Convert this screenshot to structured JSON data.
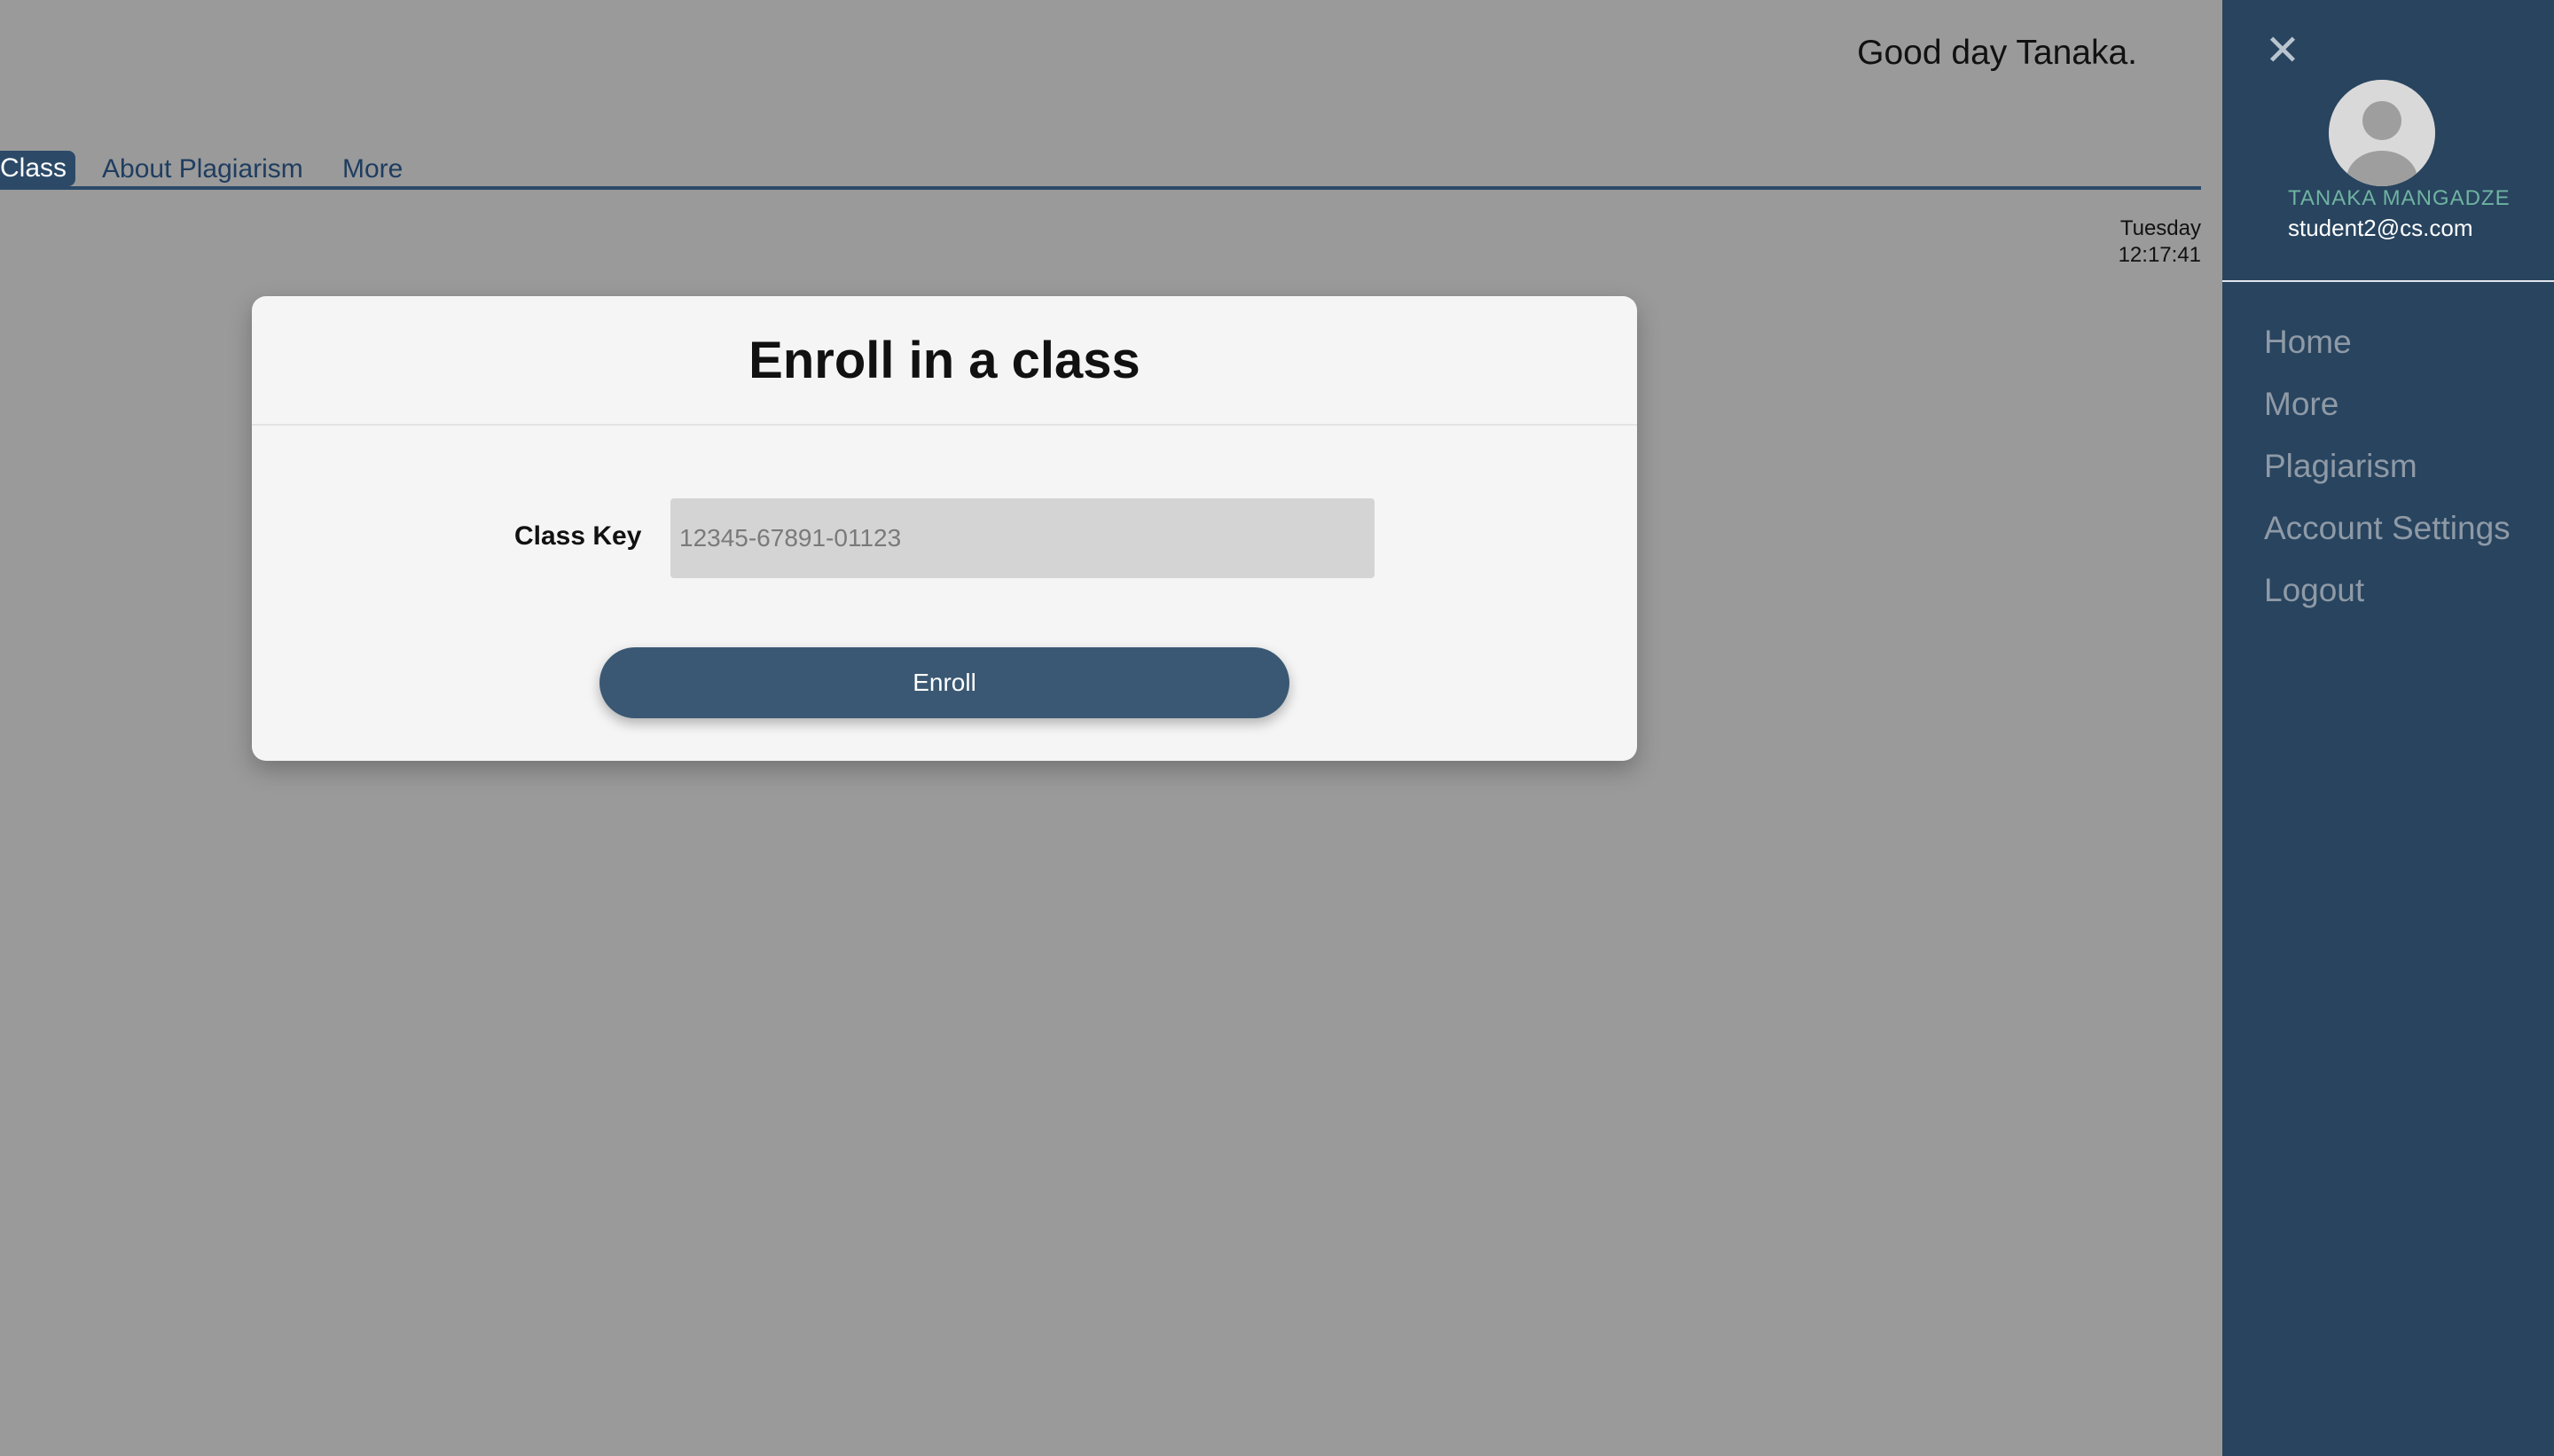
{
  "header": {
    "greeting": "Good day Tanaka."
  },
  "tabs": [
    {
      "label": "Class",
      "active": true
    },
    {
      "label": "About Plagiarism",
      "active": false
    },
    {
      "label": "More",
      "active": false
    }
  ],
  "clock": {
    "day": "Tuesday",
    "time": "12:17:41"
  },
  "modal": {
    "title": "Enroll in a class",
    "field_label": "Class Key",
    "field_placeholder": "12345-67891-01123",
    "field_value": "",
    "submit_label": "Enroll"
  },
  "sidebar": {
    "close_glyph": "✕",
    "avatar_icon": "user-avatar-icon",
    "user_name": "TANAKA MANGADZE",
    "user_email": "student2@cs.com",
    "menu": [
      {
        "label": "Home"
      },
      {
        "label": "More"
      },
      {
        "label": "Plagiarism"
      },
      {
        "label": "Account Settings"
      },
      {
        "label": "Logout"
      }
    ]
  },
  "colors": {
    "overlay": "#9a9a9a",
    "sidebar_bg": "#28445f",
    "accent": "#3a5873",
    "user_name": "#6fb3a1"
  }
}
